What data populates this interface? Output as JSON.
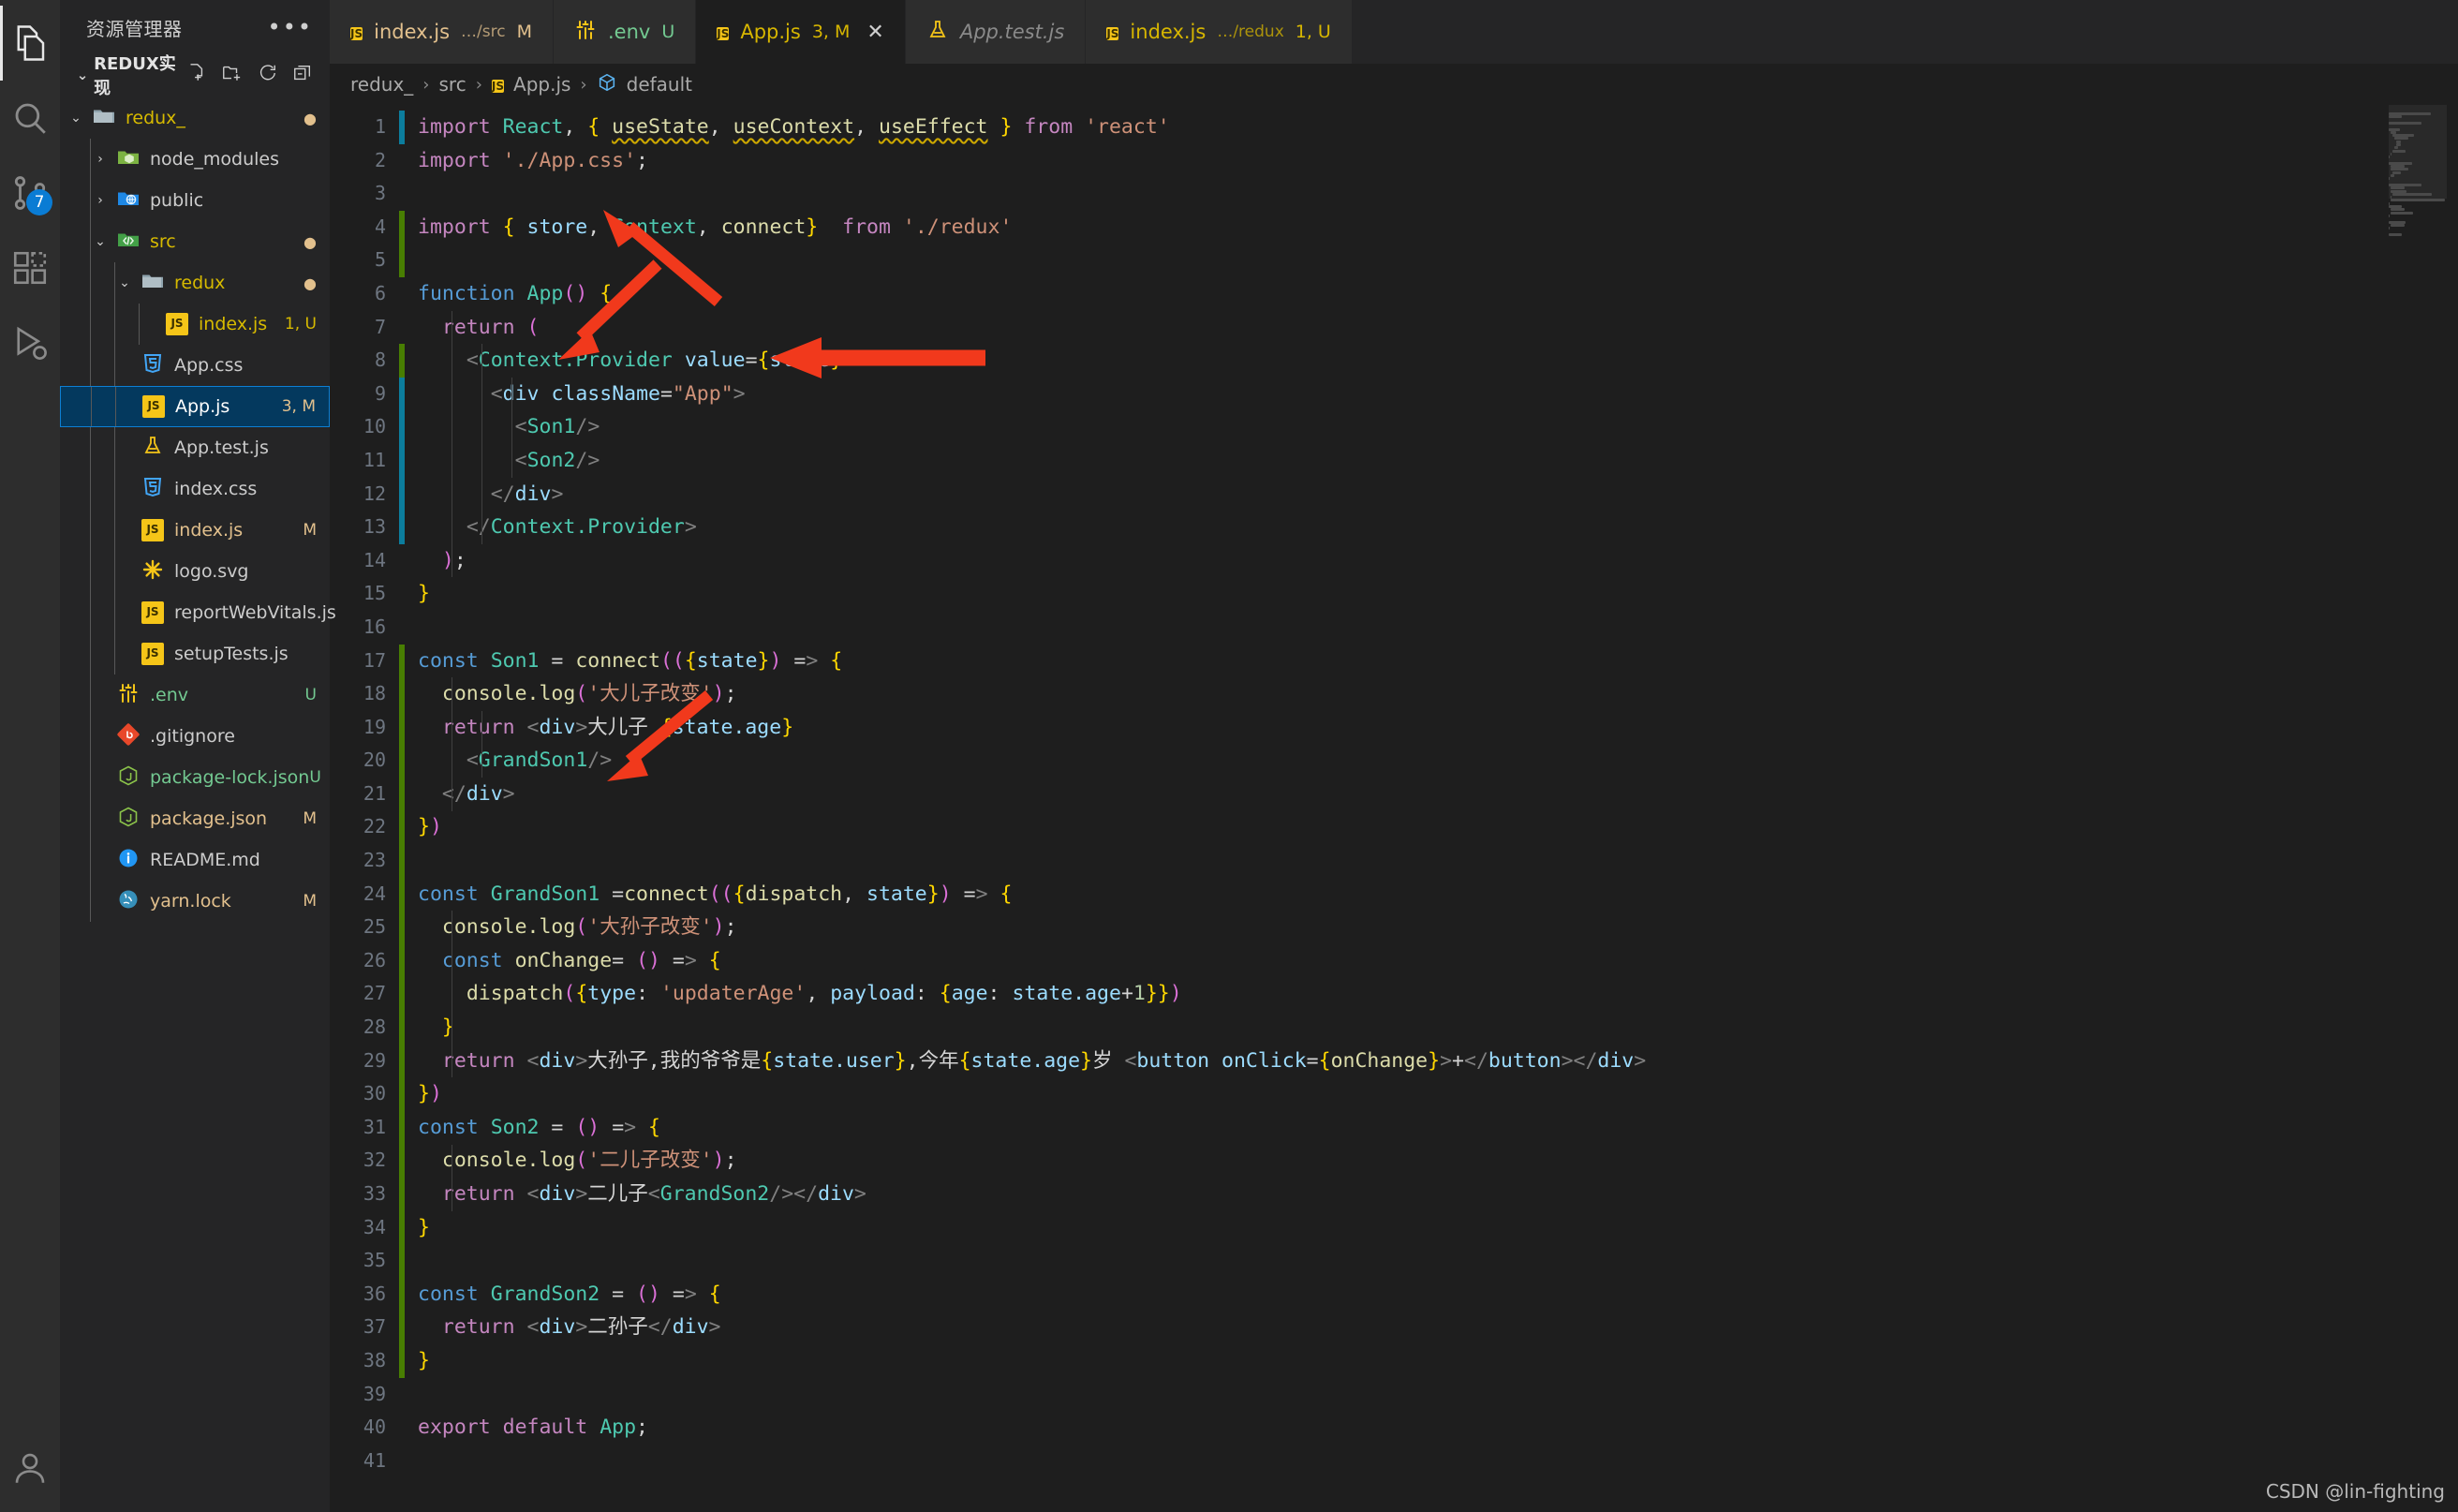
{
  "activitybar": {
    "items": [
      {
        "name": "explorer",
        "icon": "files-icon",
        "active": true,
        "badge": ""
      },
      {
        "name": "search",
        "icon": "search-icon",
        "active": false,
        "badge": ""
      },
      {
        "name": "source-control",
        "icon": "source-control-icon",
        "active": false,
        "badge": "7"
      },
      {
        "name": "extensions",
        "icon": "extensions-icon",
        "active": false,
        "badge": ""
      },
      {
        "name": "run-and-debug",
        "icon": "run-debug-icon",
        "active": false,
        "badge": ""
      }
    ],
    "bottom": [
      {
        "name": "accounts",
        "icon": "account-icon"
      }
    ]
  },
  "sidebar": {
    "title": "资源管理器",
    "more_label": "…",
    "section": {
      "label": "REDUX实现",
      "twisty": "⌄",
      "actions": [
        "new-file-icon",
        "new-folder-icon",
        "refresh-icon",
        "collapse-all-icon"
      ]
    },
    "tree": [
      {
        "label": "redux_",
        "icon": "folder-icon",
        "indent": 1,
        "twisty": "⌄",
        "color": "yellow",
        "deco": "●",
        "type": "folder"
      },
      {
        "label": "node_modules",
        "icon": "node-folder-icon",
        "indent": 2,
        "twisty": "›",
        "color": "default",
        "deco": "",
        "type": "folder"
      },
      {
        "label": "public",
        "icon": "public-folder-icon",
        "indent": 2,
        "twisty": "›",
        "color": "default",
        "deco": "",
        "type": "folder"
      },
      {
        "label": "src",
        "icon": "src-folder-icon",
        "indent": 2,
        "twisty": "⌄",
        "color": "yellow",
        "deco": "●",
        "type": "folder"
      },
      {
        "label": "redux",
        "icon": "folder-icon",
        "indent": 3,
        "twisty": "⌄",
        "color": "yellow",
        "deco": "●",
        "type": "folder"
      },
      {
        "label": "index.js",
        "icon": "js-icon",
        "indent": 4,
        "twisty": "",
        "color": "yellow",
        "deco": "1, U",
        "type": "file"
      },
      {
        "label": "App.css",
        "icon": "css-icon",
        "indent": 3,
        "twisty": "",
        "color": "default",
        "deco": "",
        "type": "file"
      },
      {
        "label": "App.js",
        "icon": "js-icon",
        "indent": 3,
        "twisty": "",
        "color": "selected",
        "deco": "3, M",
        "type": "file",
        "selected": true
      },
      {
        "label": "App.test.js",
        "icon": "test-icon",
        "indent": 3,
        "twisty": "",
        "color": "default",
        "deco": "",
        "type": "file"
      },
      {
        "label": "index.css",
        "icon": "css-icon",
        "indent": 3,
        "twisty": "",
        "color": "default",
        "deco": "",
        "type": "file"
      },
      {
        "label": "index.js",
        "icon": "js-icon",
        "indent": 3,
        "twisty": "",
        "color": "mod",
        "deco": "M",
        "type": "file"
      },
      {
        "label": "logo.svg",
        "icon": "svg-icon",
        "indent": 3,
        "twisty": "",
        "color": "default",
        "deco": "",
        "type": "file"
      },
      {
        "label": "reportWebVitals.js",
        "icon": "js-icon",
        "indent": 3,
        "twisty": "",
        "color": "default",
        "deco": "",
        "type": "file"
      },
      {
        "label": "setupTests.js",
        "icon": "js-icon",
        "indent": 3,
        "twisty": "",
        "color": "default",
        "deco": "",
        "type": "file"
      },
      {
        "label": ".env",
        "icon": "env-icon",
        "indent": 2,
        "twisty": "",
        "color": "untracked",
        "deco": "U",
        "type": "file"
      },
      {
        "label": ".gitignore",
        "icon": "git-icon",
        "indent": 2,
        "twisty": "",
        "color": "default",
        "deco": "",
        "type": "file"
      },
      {
        "label": "package-lock.json",
        "icon": "node-icon",
        "indent": 2,
        "twisty": "",
        "color": "untracked",
        "deco": "U",
        "type": "file"
      },
      {
        "label": "package.json",
        "icon": "node-icon",
        "indent": 2,
        "twisty": "",
        "color": "mod",
        "deco": "M",
        "type": "file"
      },
      {
        "label": "README.md",
        "icon": "info-icon",
        "indent": 2,
        "twisty": "",
        "color": "default",
        "deco": "",
        "type": "file"
      },
      {
        "label": "yarn.lock",
        "icon": "yarn-icon",
        "indent": 2,
        "twisty": "",
        "color": "mod",
        "deco": "M",
        "type": "file"
      }
    ]
  },
  "tabs": [
    {
      "name": "index.js",
      "desc": "…/src",
      "status": "M",
      "icon": "js-icon",
      "active": false,
      "preview": false,
      "tone": "mod",
      "close": false
    },
    {
      "name": ".env",
      "desc": "",
      "status": "U",
      "icon": "env-icon",
      "active": false,
      "preview": false,
      "tone": "untracked",
      "close": false
    },
    {
      "name": "App.js",
      "desc": "",
      "status": "3, M",
      "icon": "js-icon",
      "active": true,
      "preview": false,
      "tone": "yellowish",
      "close": true,
      "close_glyph": "✕"
    },
    {
      "name": "App.test.js",
      "desc": "",
      "status": "",
      "icon": "test-icon",
      "active": false,
      "preview": true,
      "tone": "default",
      "close": false
    },
    {
      "name": "index.js",
      "desc": "…/redux",
      "status": "1, U",
      "icon": "js-icon",
      "active": false,
      "preview": false,
      "tone": "yellowish",
      "close": false
    }
  ],
  "breadcrumb": {
    "parts": [
      "redux_",
      "src",
      "App.js",
      "default"
    ],
    "separator": "›",
    "file_icon": "js-icon",
    "symbol_icon": "symbol-object-icon"
  },
  "editor": {
    "first_line": 1,
    "total_lines": 41,
    "line_numbers": [
      1,
      2,
      3,
      4,
      5,
      6,
      7,
      8,
      9,
      10,
      11,
      12,
      13,
      14,
      15,
      16,
      17,
      18,
      19,
      20,
      21,
      22,
      23,
      24,
      25,
      26,
      27,
      28,
      29,
      30,
      31,
      32,
      33,
      34,
      35,
      36,
      37,
      38,
      39,
      40,
      41
    ],
    "git_markers": [
      "mod",
      "none",
      "none",
      "add",
      "add",
      "none",
      "none",
      "add",
      "mod",
      "mod",
      "mod",
      "mod",
      "mod",
      "none",
      "none",
      "none",
      "add",
      "add",
      "add",
      "add",
      "add",
      "add",
      "add",
      "add",
      "add",
      "add",
      "add",
      "add",
      "add",
      "add",
      "add",
      "add",
      "add",
      "add",
      "add",
      "add",
      "add",
      "add",
      "none",
      "none",
      "none"
    ],
    "lines": [
      "import React, { useState, useContext, useEffect } from 'react'",
      "import './App.css';",
      "",
      "import { store, Context, connect}  from './redux'",
      "",
      "function App() {",
      "  return (",
      "    <Context.Provider value={store}>",
      "      <div className=\"App\">",
      "        <Son1/>",
      "        <Son2/>",
      "      </div>",
      "    </Context.Provider>",
      "  );",
      "}",
      "",
      "const Son1 = connect(({state}) => {",
      "  console.log('大儿子改变');",
      "  return <div>大儿子 {state.age}",
      "    <GrandSon1/>",
      "  </div>",
      "})",
      "",
      "const GrandSon1 =connect(({dispatch, state}) => {",
      "  console.log('大孙子改变');",
      "  const onChange= () => {",
      "    dispatch({type: 'updaterAge', payload: {age: state.age+1}})",
      "  }",
      "  return <div>大孙子,我的爷爷是{state.user},今年{state.age}岁 <button onClick={onChange}>+</button></div>",
      "})",
      "const Son2 = () => {",
      "  console.log('二儿子改变');",
      "  return <div>二儿子<GrandSon2/></div>",
      "}",
      "",
      "const GrandSon2 = () => {",
      "  return <div>二孙子</div>",
      "}",
      "",
      "export default App;",
      ""
    ]
  },
  "annotations": {
    "arrows": [
      {
        "name": "arrow-to-import-redux",
        "label": ""
      },
      {
        "name": "arrow-to-context-provider",
        "label": ""
      },
      {
        "name": "arrow-right-to-provider-line",
        "label": ""
      },
      {
        "name": "arrow-to-grandson1-connect",
        "label": ""
      }
    ]
  },
  "watermark": {
    "text": "CSDN @lin-fighting"
  },
  "colors": {
    "accent_blue": "#0d7fd4",
    "selection_bg": "#04395e",
    "editor_bg": "#1e1e1e",
    "sidebar_bg": "#252526",
    "activitybar_bg": "#2d2d2d",
    "git_add": "#487e02",
    "git_mod": "#0c7d9d",
    "modified_text": "#e2c08d",
    "untracked_text": "#73c991",
    "arrow_red": "#f1391c"
  }
}
